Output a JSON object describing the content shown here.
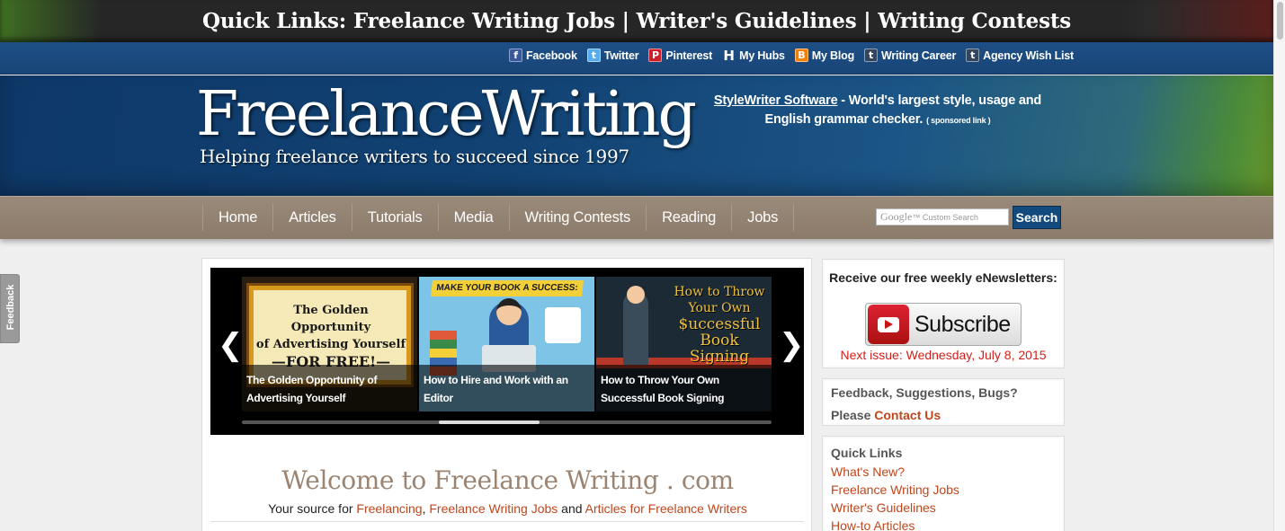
{
  "topbar": {
    "quick_links": "Quick Links: Freelance Writing Jobs | Writer's Guidelines | Writing Contests"
  },
  "social": [
    {
      "label": "Facebook",
      "icon": "facebook-icon",
      "glyph": "f"
    },
    {
      "label": "Twitter",
      "icon": "twitter-icon",
      "glyph": "t"
    },
    {
      "label": "Pinterest",
      "icon": "pinterest-icon",
      "glyph": "P"
    },
    {
      "label": "My Hubs",
      "icon": "hubpages-icon",
      "glyph": "H"
    },
    {
      "label": "My Blog",
      "icon": "blogger-icon",
      "glyph": "B"
    },
    {
      "label": "Writing Career",
      "icon": "tumblr-icon",
      "glyph": "t"
    },
    {
      "label": "Agency Wish List",
      "icon": "tumblr-icon",
      "glyph": "t"
    }
  ],
  "header": {
    "logo": "FreelanceWriting",
    "tagline": "Helping freelance writers to succeed since 1997",
    "ad_link": "StyleWriter Software",
    "ad_text": " - World's largest style, usage and English grammar checker.",
    "ad_sponsored": "( sponsored link )"
  },
  "nav": {
    "items": [
      "Home",
      "Articles",
      "Tutorials",
      "Media",
      "Writing Contests",
      "Reading",
      "Jobs"
    ],
    "search_placeholder_brand": "Google",
    "search_placeholder": "Custom Search",
    "search_button": "Search"
  },
  "slider": {
    "prev": "❮",
    "next": "❯",
    "slides": [
      {
        "caption": "The Golden Opportunity of Advertising Yourself",
        "art_line1": "The Golden Opportunity",
        "art_line2": "of Advertising Yourself",
        "art_line3": "—FOR FREE!—"
      },
      {
        "caption": "How to Hire and Work with an Editor",
        "art_banner": "MAKE YOUR BOOK A SUCCESS:"
      },
      {
        "caption": "How to Throw Your Own Successful Book Signing",
        "art_line1": "How to Throw",
        "art_line2": "Your Own",
        "art_line3": "$uccessful",
        "art_line4": "Book Signing"
      }
    ],
    "progress": 0.19
  },
  "main": {
    "welcome": "Welcome to Freelance Writing . com",
    "sub_prefix": "Your source for ",
    "sub_link1": "Freelancing",
    "sub_sep1": ", ",
    "sub_link2": "Freelance Writing Jobs",
    "sub_sep2": " and ",
    "sub_link3": "Articles for Freelance Writers"
  },
  "sidebar": {
    "newsletter_title": "Receive our free weekly eNewsletters:",
    "subscribe": "Subscribe",
    "next_issue": "Next issue: Wednesday, July 8, 2015",
    "feedback_title": "Feedback, Suggestions, Bugs?",
    "feedback_prefix": "Please ",
    "contact": "Contact Us",
    "quick_links_title": "Quick Links",
    "quick_links": [
      "What's New?",
      "Freelance Writing Jobs",
      "Writer's Guidelines",
      "How-to Articles"
    ]
  },
  "feedback_tab": "Feedback",
  "colors": {
    "link": "#c0461c",
    "nav": "#8c7b6a",
    "header_blue": "#114273",
    "alert_red": "#d4201a"
  }
}
